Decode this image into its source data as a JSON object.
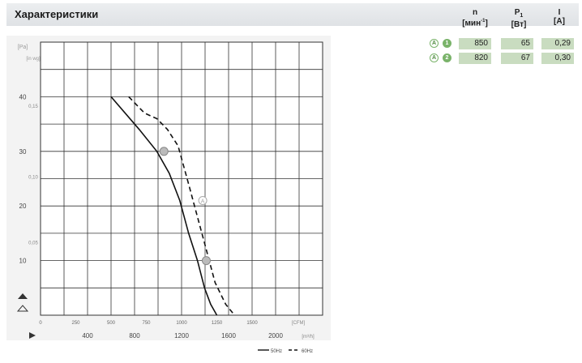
{
  "header": {
    "title": "Характеристики"
  },
  "table": {
    "columns": [
      {
        "symbol": "n",
        "sub": "",
        "unit": "[мин",
        "unit_sup": "-1",
        "unit_end": "]"
      },
      {
        "symbol": "P",
        "sub": "1",
        "unit": "[Вт]",
        "unit_sup": "",
        "unit_end": ""
      },
      {
        "symbol": "I",
        "sub": "",
        "unit": "[A]",
        "unit_sup": "",
        "unit_end": ""
      }
    ],
    "rows": [
      {
        "point_icon": "A",
        "number_icon": "1",
        "n": "850",
        "p1": "65",
        "i": "0,29"
      },
      {
        "point_icon": "A",
        "number_icon": "2",
        "n": "820",
        "p1": "67",
        "i": "0,30"
      }
    ]
  },
  "chart_data": {
    "type": "line",
    "xlim": [
      0,
      1600
    ],
    "ylim": [
      0,
      50
    ],
    "x_ticks": [
      {
        "v": 0,
        "label": "0"
      },
      {
        "v": 200,
        "label": "250"
      },
      {
        "v": 400,
        "label": "500"
      },
      {
        "v": 600,
        "label": "750"
      },
      {
        "v": 800,
        "label": "1000"
      },
      {
        "v": 1000,
        "label": "1250"
      },
      {
        "v": 1200,
        "label": "1500"
      }
    ],
    "x_unit_top": "[CFM]",
    "x_ticks_bottom": [
      {
        "v": 400,
        "label": "400"
      },
      {
        "v": 800,
        "label": "800"
      },
      {
        "v": 1200,
        "label": "1200"
      },
      {
        "v": 1600,
        "label": "1600"
      },
      {
        "v": 2000,
        "label": "2000"
      }
    ],
    "x_unit_bottom": "[m³/h]",
    "y_ticks_left": [
      {
        "v": 10,
        "label": "10"
      },
      {
        "v": 20,
        "label": "20"
      },
      {
        "v": 30,
        "label": "30"
      },
      {
        "v": 40,
        "label": "40"
      }
    ],
    "y_unit_left": "[Pa]",
    "y_ticks_right": [
      {
        "v": 13,
        "label": "0,05"
      },
      {
        "v": 25,
        "label": "0,10"
      },
      {
        "v": 38,
        "label": "0,15"
      }
    ],
    "y_unit_right": "[in wg]",
    "series": [
      {
        "name": "50Hz",
        "dash": false,
        "x": [
          400,
          560,
          660,
          730,
          790,
          840,
          890,
          930,
          965,
          1000
        ],
        "y": [
          40,
          34,
          30,
          26,
          21,
          15,
          10,
          5,
          2,
          0
        ]
      },
      {
        "name": "60Hz",
        "dash": true,
        "x": [
          500,
          590,
          660,
          720,
          780,
          840,
          890,
          940,
          990,
          1050,
          1100
        ],
        "y": [
          40,
          37,
          36,
          34,
          31,
          24,
          18,
          12,
          6,
          2,
          0
        ]
      }
    ],
    "markers": [
      {
        "x": 700,
        "y": 30
      },
      {
        "x": 940,
        "y": 10
      }
    ],
    "annotation": {
      "x": 920,
      "y": 21,
      "label": "A"
    },
    "legend": {
      "placement": "bottom-right",
      "entries": [
        "50Hz",
        "60Hz"
      ]
    }
  }
}
